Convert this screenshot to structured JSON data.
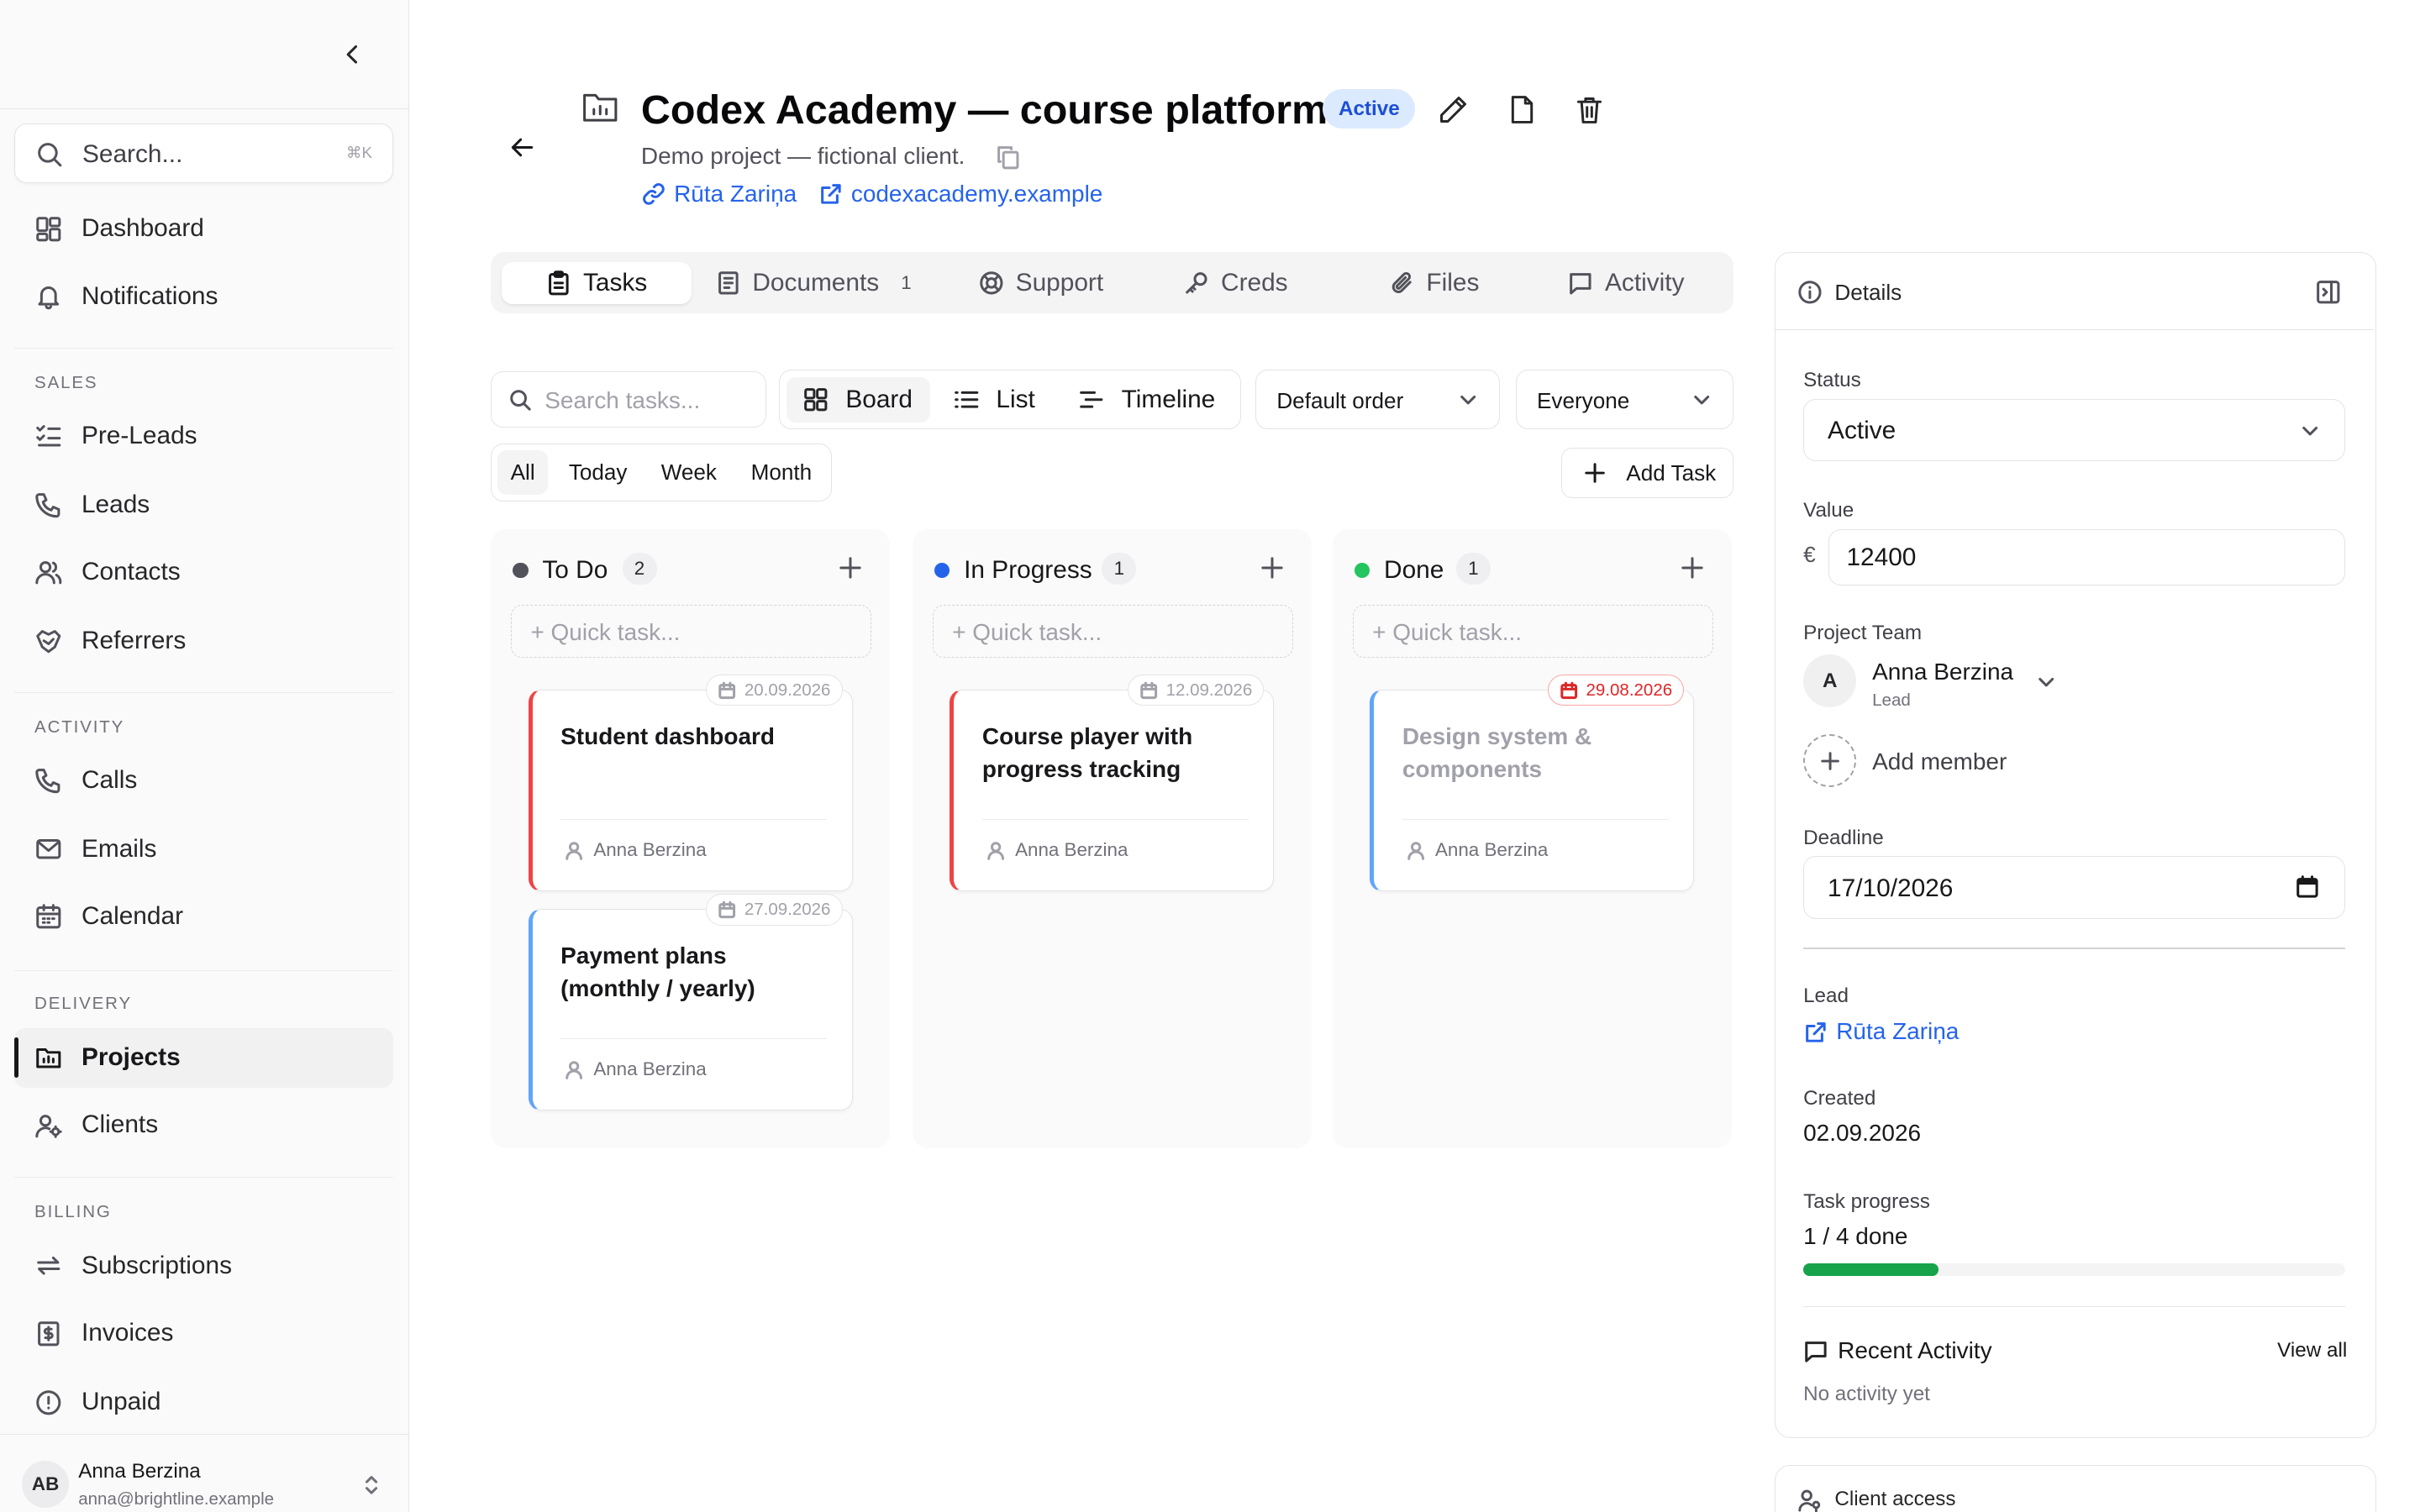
{
  "sidebar": {
    "search": {
      "placeholder": "Search...",
      "shortcut": "⌘K"
    },
    "top_items": [
      {
        "label": "Dashboard",
        "icon": "dashboard-icon"
      },
      {
        "label": "Notifications",
        "icon": "bell-icon"
      }
    ],
    "groups": [
      {
        "label": "SALES",
        "items": [
          {
            "label": "Pre-Leads",
            "icon": "list-check-icon"
          },
          {
            "label": "Leads",
            "icon": "phone-icon"
          },
          {
            "label": "Contacts",
            "icon": "users-icon"
          },
          {
            "label": "Referrers",
            "icon": "handshake-icon"
          }
        ]
      },
      {
        "label": "ACTIVITY",
        "items": [
          {
            "label": "Calls",
            "icon": "phone-icon"
          },
          {
            "label": "Emails",
            "icon": "mail-icon"
          },
          {
            "label": "Calendar",
            "icon": "calendar-icon"
          }
        ]
      },
      {
        "label": "DELIVERY",
        "items": [
          {
            "label": "Projects",
            "icon": "folder-icon",
            "active": true
          },
          {
            "label": "Clients",
            "icon": "user-settings-icon"
          }
        ]
      },
      {
        "label": "BILLING",
        "items": [
          {
            "label": "Subscriptions",
            "icon": "repeat-icon"
          },
          {
            "label": "Invoices",
            "icon": "receipt-icon"
          },
          {
            "label": "Unpaid",
            "icon": "alert-circle-icon"
          }
        ]
      }
    ],
    "user": {
      "initials": "AB",
      "name": "Anna Berzina",
      "email": "anna@brightline.example"
    }
  },
  "header": {
    "title": "Codex Academy — course platform",
    "status": "Active",
    "description": "Demo project — fictional client.",
    "contact_link": "Rūta Zariņa",
    "website_link": "codexacademy.example"
  },
  "tabs": [
    {
      "label": "Tasks",
      "icon": "clipboard-icon",
      "active": true
    },
    {
      "label": "Documents",
      "icon": "document-icon",
      "count": "1"
    },
    {
      "label": "Support",
      "icon": "lifebuoy-icon"
    },
    {
      "label": "Creds",
      "icon": "key-icon"
    },
    {
      "label": "Files",
      "icon": "paperclip-icon"
    },
    {
      "label": "Activity",
      "icon": "message-icon"
    }
  ],
  "toolbar": {
    "search_placeholder": "Search tasks...",
    "views": [
      {
        "label": "Board",
        "icon": "grid-icon",
        "active": true
      },
      {
        "label": "List",
        "icon": "list-icon"
      },
      {
        "label": "Timeline",
        "icon": "timeline-icon"
      }
    ],
    "order_select": "Default order",
    "assignee_select": "Everyone",
    "periods": [
      {
        "label": "All",
        "active": true
      },
      {
        "label": "Today"
      },
      {
        "label": "Week"
      },
      {
        "label": "Month"
      }
    ],
    "add_task_label": "Add Task"
  },
  "board": {
    "quick_task_placeholder": "+ Quick task...",
    "columns": [
      {
        "title": "To Do",
        "count": "2",
        "dot_color": "#52525b",
        "cards": [
          {
            "title": "Student dashboard",
            "date": "20.09.2026",
            "assignee": "Anna Berzina",
            "accent": "#ef4444"
          },
          {
            "title": "Payment plans (monthly / yearly)",
            "date": "27.09.2026",
            "assignee": "Anna Berzina",
            "accent": "#60a5fa"
          }
        ]
      },
      {
        "title": "In Progress",
        "count": "1",
        "dot_color": "#2563eb",
        "cards": [
          {
            "title": "Course player with progress tracking",
            "date": "12.09.2026",
            "assignee": "Anna Berzina",
            "accent": "#ef4444"
          }
        ]
      },
      {
        "title": "Done",
        "count": "1",
        "dot_color": "#22c55e",
        "cards": [
          {
            "title": "Design system & components",
            "date": "29.08.2026",
            "assignee": "Anna Berzina",
            "accent": "#60a5fa",
            "overdue": true,
            "done": true
          }
        ]
      }
    ]
  },
  "details": {
    "title": "Details",
    "status_label": "Status",
    "status_value": "Active",
    "value_label": "Value",
    "currency": "€",
    "value": "12400",
    "team_label": "Project Team",
    "member": {
      "initial": "A",
      "name": "Anna Berzina",
      "role": "Lead"
    },
    "add_member_label": "Add member",
    "deadline_label": "Deadline",
    "deadline_value": "17/10/2026",
    "lead_label": "Lead",
    "lead_value": "Rūta Zariņa",
    "created_label": "Created",
    "created_value": "02.09.2026",
    "progress_label": "Task progress",
    "progress_text": "1 / 4 done",
    "progress_fraction": 0.25,
    "recent_activity_title": "Recent Activity",
    "view_all_label": "View all",
    "no_activity_text": "No activity yet"
  },
  "client_access": {
    "title": "Client access"
  }
}
